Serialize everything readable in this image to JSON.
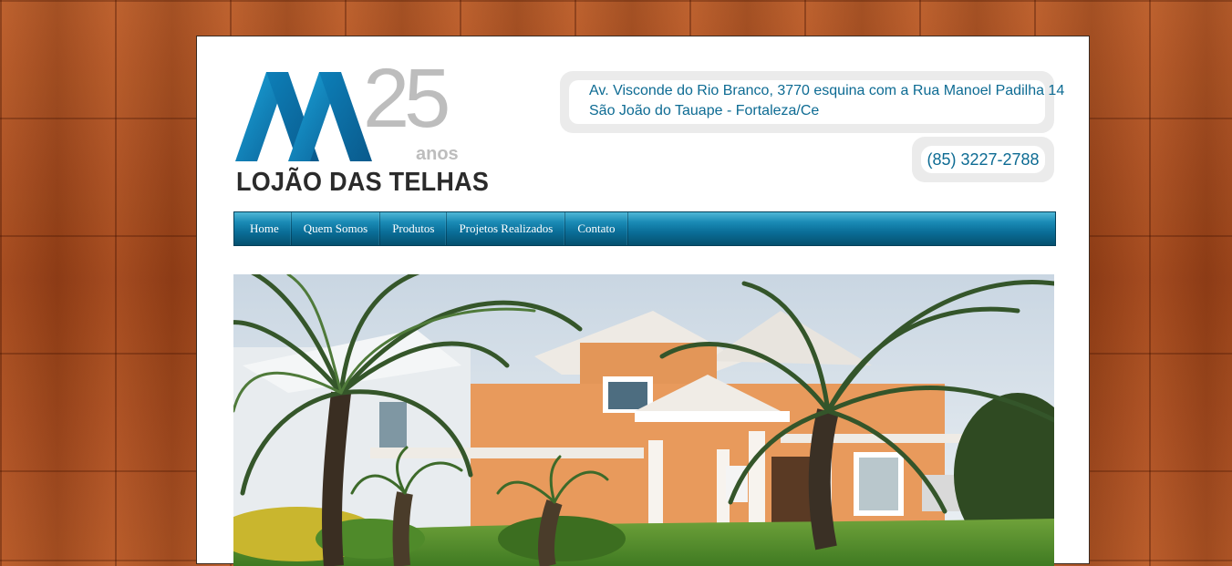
{
  "logo": {
    "number": "25",
    "anos": "anos",
    "brand": "LOJÃO DAS TELHAS",
    "colors": {
      "blue_light": "#1a9fd3",
      "blue_dark": "#0b5f95",
      "gray": "#bdbdbd",
      "text": "#2b2b2b"
    }
  },
  "contact": {
    "address_line1": "Av. Visconde do Rio Branco, 3770 esquina com a Rua Manoel Padilha 14",
    "address_line2": "São João do Tauape - Fortaleza/Ce",
    "phone": "(85) 3227-2788",
    "text_color": "#0d6b93"
  },
  "nav": {
    "items": [
      {
        "label": "Home"
      },
      {
        "label": "Quem Somos"
      },
      {
        "label": "Produtos"
      },
      {
        "label": "Projetos Realizados"
      },
      {
        "label": "Contato"
      }
    ],
    "accent": "#0a6e98"
  },
  "hero": {
    "icons": [
      "house-photo"
    ]
  }
}
